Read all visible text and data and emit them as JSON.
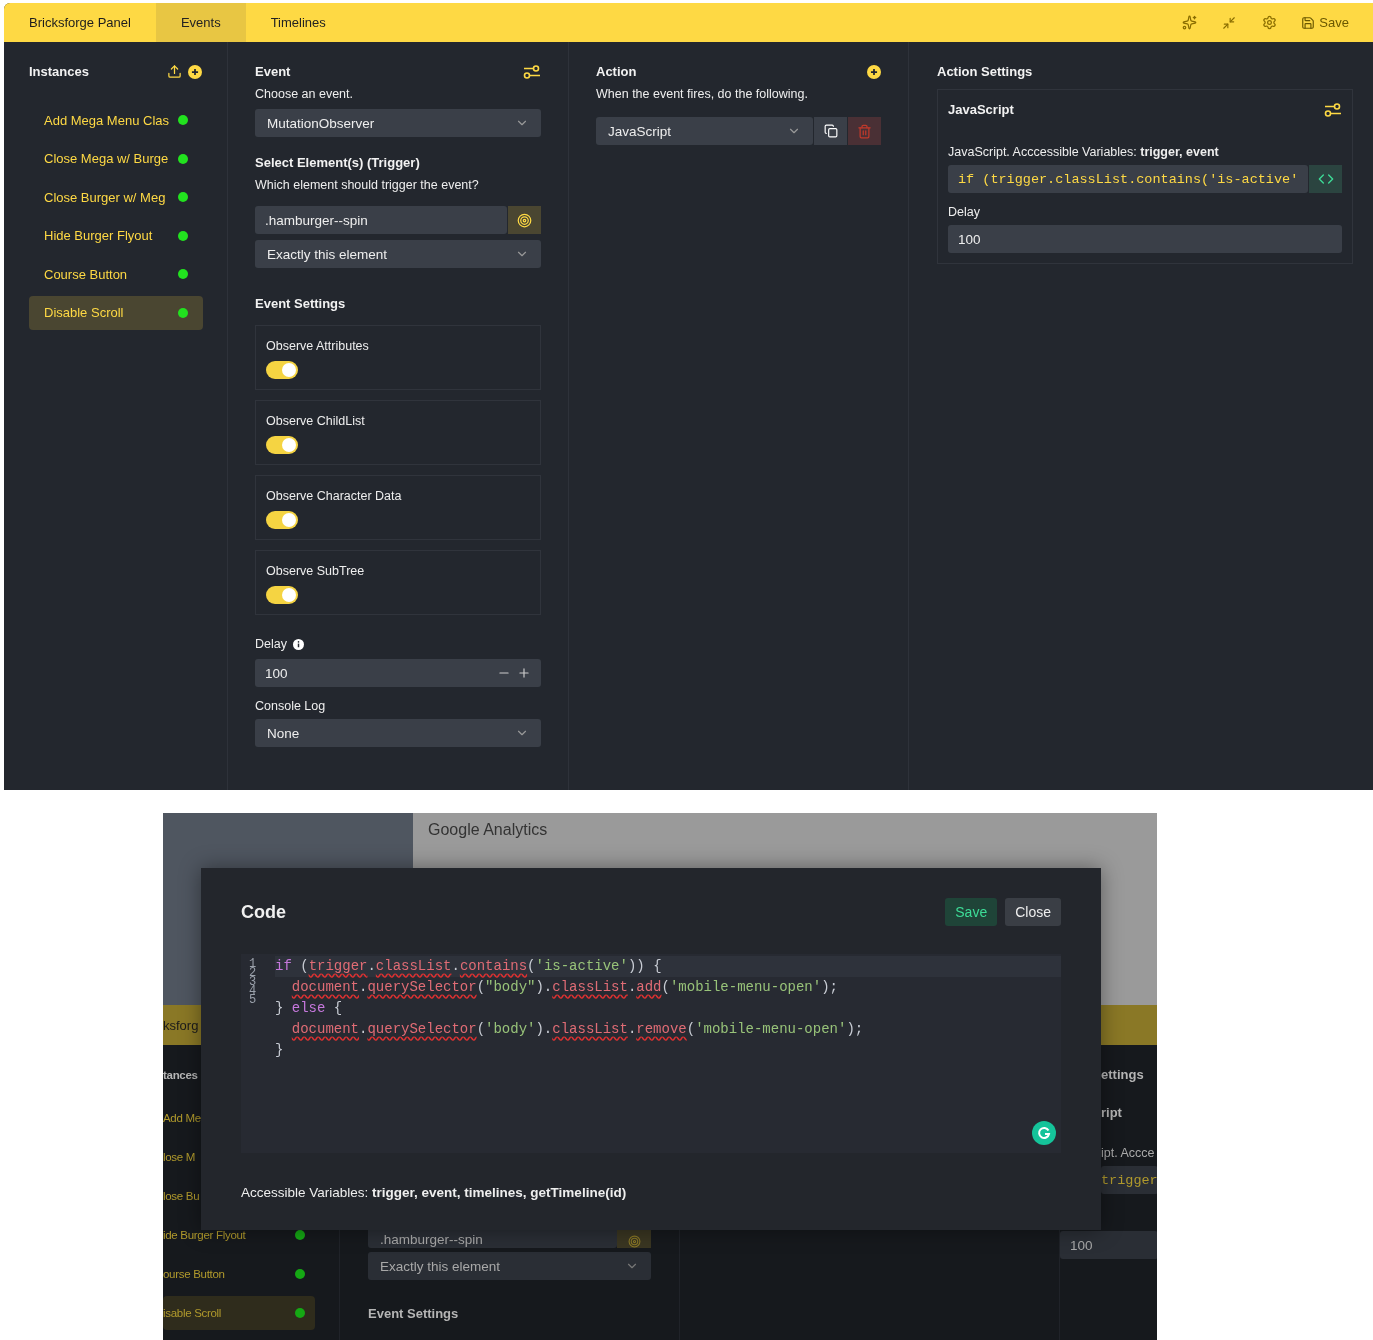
{
  "panel": {
    "brand": "Bricksforge Panel",
    "tabs": [
      {
        "label": "Events",
        "selected": true
      },
      {
        "label": "Timelines",
        "selected": false
      }
    ],
    "toolbar": {
      "save_label": "Save"
    },
    "instances": {
      "title": "Instances",
      "items": [
        {
          "label": "Add Mega Menu Clas",
          "enabled": true,
          "selected": false
        },
        {
          "label": "Close Mega w/ Burge",
          "enabled": true,
          "selected": false
        },
        {
          "label": "Close Burger w/ Meg",
          "enabled": true,
          "selected": false
        },
        {
          "label": "Hide Burger Flyout",
          "enabled": true,
          "selected": false
        },
        {
          "label": "Course Button",
          "enabled": true,
          "selected": false
        },
        {
          "label": "Disable Scroll",
          "enabled": true,
          "selected": true
        }
      ]
    },
    "event": {
      "title": "Event",
      "hint": "Choose an event.",
      "event_type": "MutationObserver",
      "trigger_title": "Select Element(s) (Trigger)",
      "trigger_hint": "Which element should trigger the event?",
      "selector": ".hamburger--spin",
      "match": "Exactly this element",
      "settings_title": "Event Settings",
      "settings": [
        {
          "label": "Observe Attributes",
          "on": true
        },
        {
          "label": "Observe ChildList",
          "on": true
        },
        {
          "label": "Observe Character Data",
          "on": true
        },
        {
          "label": "Observe SubTree",
          "on": true
        }
      ],
      "delay_label": "Delay",
      "delay": "100",
      "console_label": "Console Log",
      "console": "None"
    },
    "action": {
      "title": "Action",
      "hint": "When the event fires, do the following.",
      "type": "JavaScript"
    },
    "action_settings": {
      "title": "Action Settings",
      "card_title": "JavaScript",
      "code_label": "JavaScript. Acccessible Variables: **trigger, event**",
      "code_preview": "if (trigger.classList.contains('is-active'",
      "delay_label": "Delay",
      "delay": "100"
    }
  },
  "background": {
    "list_item": "Google Analytics",
    "brand": "ksforg",
    "instances_title": "tances",
    "covered_items": [
      "Add Me",
      "lose M",
      "lose Bu"
    ],
    "items": [
      {
        "label": "ide Burger Flyout",
        "selected": false
      },
      {
        "label": "ourse Button",
        "selected": false
      },
      {
        "label": "isable Scroll",
        "selected": true
      }
    ],
    "selector": ".hamburger--spin",
    "match": "Exactly this element",
    "settings_title": "Event Settings",
    "right_title": "ettings",
    "card_title": "ript",
    "code_label": "ipt. Accce",
    "code_preview": "trigger",
    "delay": "100"
  },
  "code_modal": {
    "title": "Code",
    "save": "Save",
    "close": "Close",
    "line_numbers": [
      "1",
      "2",
      "3",
      "4",
      "5"
    ],
    "lines": [
      {
        "indent": false,
        "tokens": [
          {
            "text": "if",
            "kind": "keyword"
          },
          {
            "text": " (",
            "kind": "plain"
          },
          {
            "text": "trigger",
            "kind": "error"
          },
          {
            "text": ".",
            "kind": "plain"
          },
          {
            "text": "classList",
            "kind": "error"
          },
          {
            "text": ".",
            "kind": "plain"
          },
          {
            "text": "contains",
            "kind": "error"
          },
          {
            "text": "(",
            "kind": "plain"
          },
          {
            "text": "'is-active'",
            "kind": "string"
          },
          {
            "text": ")) {",
            "kind": "plain"
          }
        ]
      },
      {
        "indent": true,
        "tokens": [
          {
            "text": "document",
            "kind": "error"
          },
          {
            "text": ".",
            "kind": "plain"
          },
          {
            "text": "querySelector",
            "kind": "error"
          },
          {
            "text": "(",
            "kind": "plain"
          },
          {
            "text": "\"body\"",
            "kind": "string"
          },
          {
            "text": ").",
            "kind": "plain"
          },
          {
            "text": "classList",
            "kind": "error"
          },
          {
            "text": ".",
            "kind": "plain"
          },
          {
            "text": "add",
            "kind": "error"
          },
          {
            "text": "(",
            "kind": "plain"
          },
          {
            "text": "'mobile-menu-open'",
            "kind": "string"
          },
          {
            "text": ");",
            "kind": "plain"
          }
        ]
      },
      {
        "indent": false,
        "tokens": [
          {
            "text": "} ",
            "kind": "plain"
          },
          {
            "text": "else",
            "kind": "keyword"
          },
          {
            "text": " {",
            "kind": "plain"
          }
        ]
      },
      {
        "indent": true,
        "tokens": [
          {
            "text": "document",
            "kind": "error"
          },
          {
            "text": ".",
            "kind": "plain"
          },
          {
            "text": "querySelector",
            "kind": "error"
          },
          {
            "text": "(",
            "kind": "plain"
          },
          {
            "text": "'body'",
            "kind": "string"
          },
          {
            "text": ").",
            "kind": "plain"
          },
          {
            "text": "classList",
            "kind": "error"
          },
          {
            "text": ".",
            "kind": "plain"
          },
          {
            "text": "remove",
            "kind": "error"
          },
          {
            "text": "(",
            "kind": "plain"
          },
          {
            "text": "'mobile-menu-open'",
            "kind": "string"
          },
          {
            "text": ");",
            "kind": "plain"
          }
        ]
      },
      {
        "indent": false,
        "tokens": [
          {
            "text": "}",
            "kind": "plain"
          }
        ]
      }
    ],
    "footer": "Accessible Variables: **trigger, event, timelines, getTimeline(id)**"
  }
}
